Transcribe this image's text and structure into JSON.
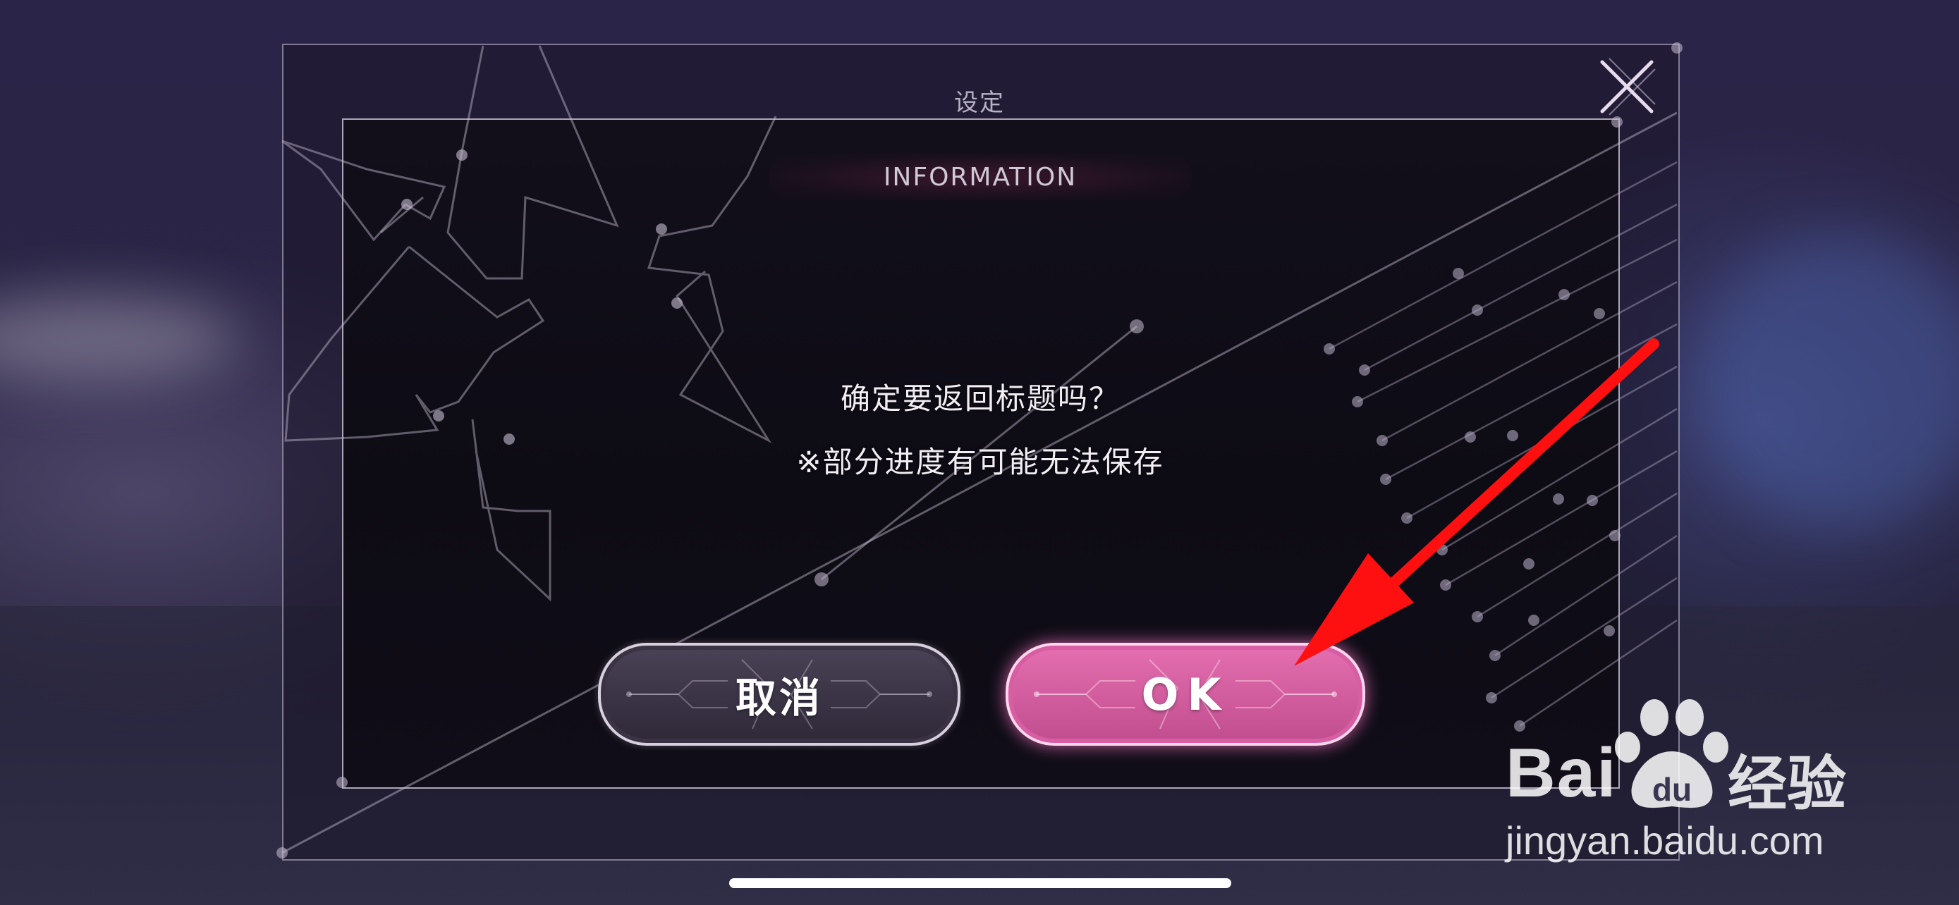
{
  "dialog": {
    "settings_title": "设定",
    "tab_label": "INFORMATION",
    "message_line1": "确定要返回标题吗？",
    "message_line2": "※部分进度有可能无法保存",
    "cancel_label": "取消",
    "ok_label": "OK"
  },
  "watermark": {
    "brand_text": "Bai",
    "brand_du": "du",
    "brand_cn": "经验",
    "url": "jingyan.baidu.com"
  },
  "colors": {
    "ok_button": "#d65c9f",
    "cancel_button": "#3c3446",
    "annotation_arrow": "#ff0000"
  },
  "icons": {
    "close": "close-x-icon",
    "arrow": "annotation-arrow-icon",
    "watermark_paw": "baidu-paw-icon"
  }
}
